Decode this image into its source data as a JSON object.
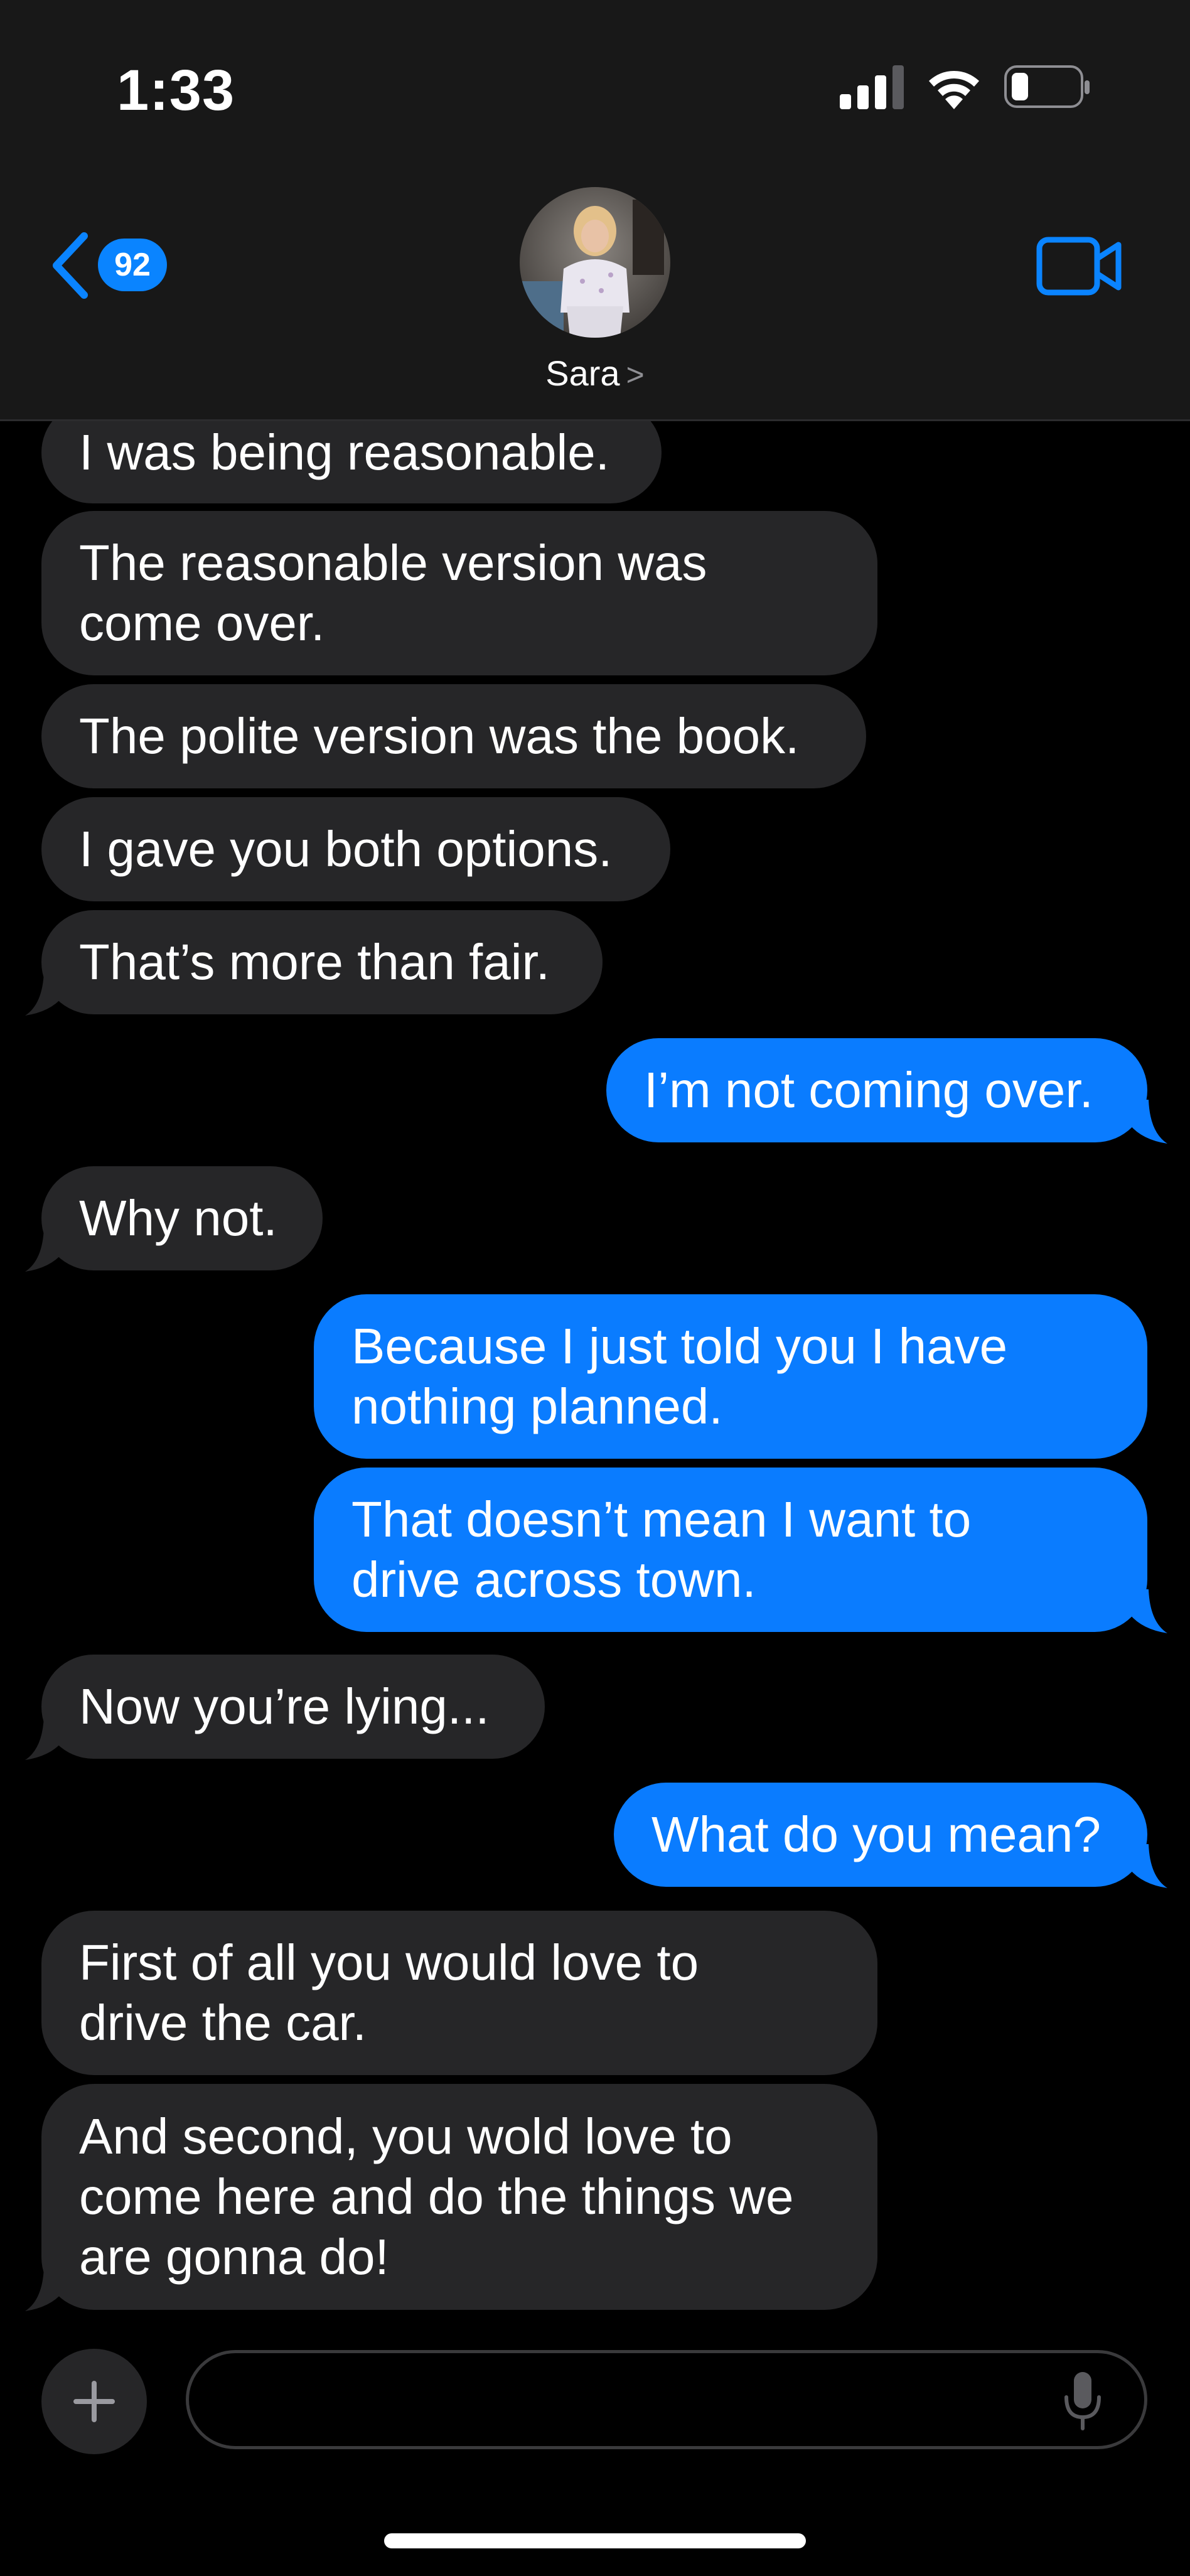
{
  "status_bar": {
    "time": "1:33"
  },
  "header": {
    "back_badge": "92",
    "contact_name": "Sara",
    "contact_chevron": ">",
    "accent_color": "#0a84ff"
  },
  "messages": [
    {
      "direction": "incoming",
      "text": "I was being reasonable."
    },
    {
      "direction": "incoming",
      "text": "The reasonable version was\ncome over."
    },
    {
      "direction": "incoming",
      "text": "The polite version was the book."
    },
    {
      "direction": "incoming",
      "text": "I gave you both options."
    },
    {
      "direction": "incoming",
      "text": "That’s more than fair."
    },
    {
      "direction": "outgoing",
      "text": "I’m not coming over."
    },
    {
      "direction": "incoming",
      "text": "Why not."
    },
    {
      "direction": "outgoing",
      "text": "Because I just told you I have\nnothing planned."
    },
    {
      "direction": "outgoing",
      "text": "That doesn’t mean I want to\ndrive across town."
    },
    {
      "direction": "incoming",
      "text": "Now you’re lying..."
    },
    {
      "direction": "outgoing",
      "text": "What do you mean?"
    },
    {
      "direction": "incoming",
      "text": "First of all you would love to\ndrive the car."
    },
    {
      "direction": "incoming",
      "text": "And second, you wold love to\ncome here and do the things we\nare gonna do!"
    }
  ],
  "composer": {
    "placeholder": "",
    "add_icon": "plus-icon",
    "mic_icon": "microphone-icon"
  },
  "colors": {
    "incoming_bubble": "#262628",
    "outgoing_bubble": "#0a7cff",
    "background": "#000000",
    "header_background": "#181818"
  }
}
